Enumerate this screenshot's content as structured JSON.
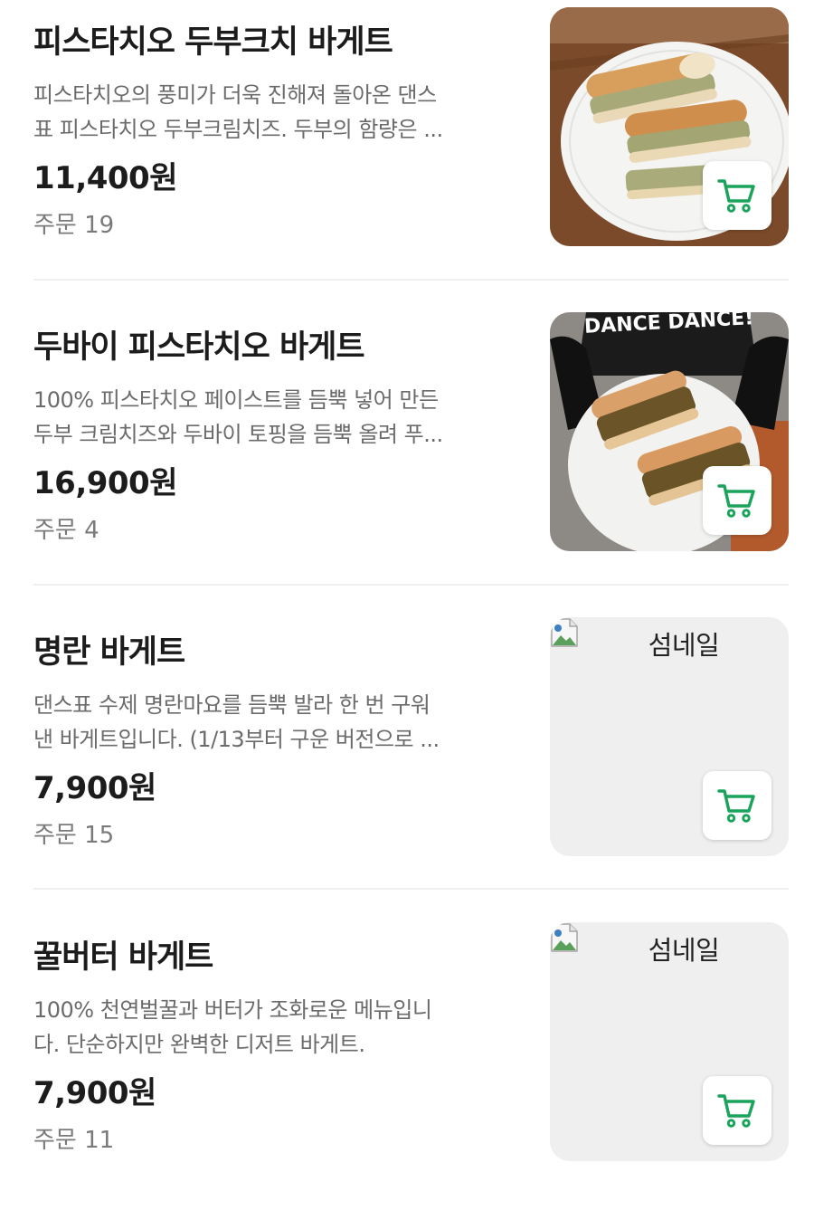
{
  "theme": {
    "accent": "#1aa35a",
    "price_color": "#1c1c1c",
    "muted_text": "#6b6b6b",
    "divider": "#efefef"
  },
  "menu": {
    "items": [
      {
        "name": "피스타치오 두부크치 바게트",
        "desc_line1": "피스타치오의 풍미가 더욱 진해져 돌아온 댄스",
        "desc_line2": "표 피스타치오 두부크림치즈. 두부의 함량은 ...",
        "price": "11,400원",
        "orders": "주문 19",
        "image": "pistachio-baguette-photo",
        "cart_icon": "cart-icon"
      },
      {
        "name": "두바이 피스타치오 바게트",
        "desc_line1": "100% 피스타치오 페이스트를 듬뿍 넣어 만든",
        "desc_line2": "두부 크림치즈와 두바이 토핑을 듬뿍 올려 푸...",
        "price": "16,900원",
        "orders": "주문 4",
        "image": "dubai-pistachio-baguette-photo",
        "image_text": "DANCE DANCE!",
        "cart_icon": "cart-icon"
      },
      {
        "name": "명란 바게트",
        "desc_line1": "댄스표 수제 명란마요를 듬뿍 발라 한 번 구워",
        "desc_line2": "낸 바게트입니다. (1/13부터 구운 버전으로 ...",
        "price": "7,900원",
        "orders": "주문 15",
        "image_alt": "섬네일",
        "cart_icon": "cart-icon"
      },
      {
        "name": "꿀버터 바게트",
        "desc_line1": "100% 천연벌꿀과 버터가 조화로운 메뉴입니",
        "desc_line2": "다. 단순하지만 완벽한 디저트 바게트.",
        "price": "7,900원",
        "orders": "주문 11",
        "image_alt": "섬네일",
        "cart_icon": "cart-icon"
      }
    ]
  }
}
